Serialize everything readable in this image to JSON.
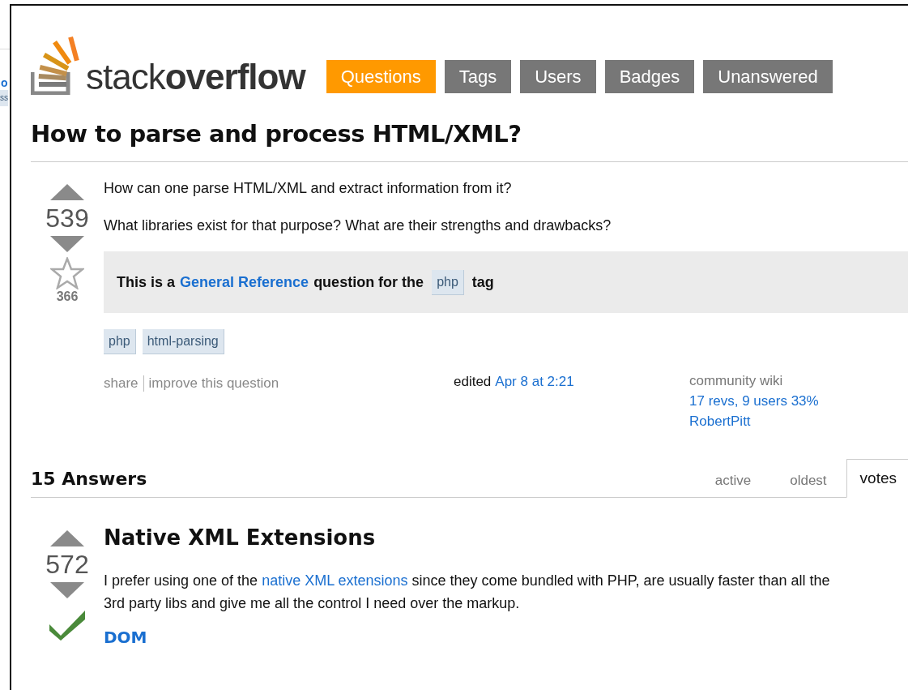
{
  "background_window": {
    "link_fragment": "o",
    "tag_fragment": "ss"
  },
  "logo": {
    "light": "stack",
    "bold": "overflow"
  },
  "nav": [
    {
      "label": "Questions",
      "selected": true
    },
    {
      "label": "Tags",
      "selected": false
    },
    {
      "label": "Users",
      "selected": false
    },
    {
      "label": "Badges",
      "selected": false
    },
    {
      "label": "Unanswered",
      "selected": false
    }
  ],
  "question": {
    "title": "How to parse and process HTML/XML?",
    "votes": "539",
    "favorites": "366",
    "favorited": false,
    "paragraphs": [
      "How can one parse HTML/XML and extract information from it?",
      "What libraries exist for that purpose? What are their strengths and drawbacks?"
    ],
    "notice": {
      "before": "This is a",
      "link": "General Reference",
      "middle": "question for the",
      "tag": "php",
      "after": "tag"
    },
    "tags": [
      "php",
      "html-parsing"
    ],
    "actions": [
      "share",
      "improve this question"
    ],
    "edited": {
      "label": "edited",
      "time": "Apr 8 at 2:21"
    },
    "owner": {
      "label": "community wiki",
      "revisions": "17 revs, 9 users 33%",
      "user": "RobertPitt"
    }
  },
  "answers": {
    "count_label": "15 Answers",
    "sort_tabs": [
      {
        "label": "active",
        "selected": false
      },
      {
        "label": "oldest",
        "selected": false
      },
      {
        "label": "votes",
        "selected": true
      }
    ]
  },
  "answer": {
    "votes": "572",
    "accepted": true,
    "heading": "Native XML Extensions",
    "text": {
      "before": "I prefer using one of the",
      "link": "native XML extensions",
      "after": "since they come bundled with PHP, are usually faster than all the 3rd party libs and give me all the control I need over the markup."
    },
    "subheading": "DOM"
  }
}
